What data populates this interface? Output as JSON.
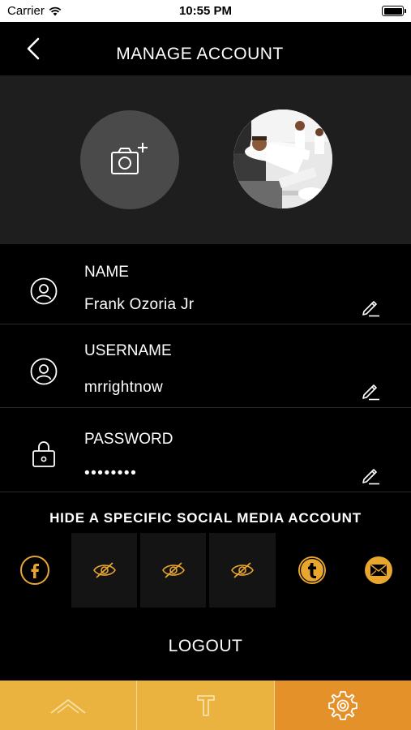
{
  "status_bar": {
    "carrier": "Carrier",
    "time": "10:55 PM"
  },
  "header": {
    "title": "MANAGE ACCOUNT",
    "back_icon": "chevron-left-icon"
  },
  "photos": {
    "add_icon": "camera-plus-icon",
    "avatar": "profile-photo"
  },
  "fields": [
    {
      "label": "NAME",
      "value": "Frank Ozoria Jr",
      "icon": "user-icon"
    },
    {
      "label": "USERNAME",
      "value": "mrrightnow",
      "icon": "user-icon"
    },
    {
      "label": "PASSWORD",
      "value": "••••••••",
      "icon": "lock-icon"
    }
  ],
  "social": {
    "heading": "HIDE A SPECIFIC SOCIAL MEDIA ACCOUNT",
    "items": [
      {
        "icon": "facebook-icon",
        "state": "visible"
      },
      {
        "icon": "eye-slash-icon",
        "state": "hidden"
      },
      {
        "icon": "eye-slash-icon",
        "state": "hidden"
      },
      {
        "icon": "eye-slash-icon",
        "state": "hidden"
      },
      {
        "icon": "tumblr-icon",
        "state": "visible"
      },
      {
        "icon": "mail-icon",
        "state": "visible"
      }
    ]
  },
  "logout_label": "LOGOUT",
  "tabs": [
    {
      "icon": "home-icon",
      "active": false
    },
    {
      "icon": "t-icon",
      "active": false
    },
    {
      "icon": "gear-icon",
      "active": true
    }
  ],
  "colors": {
    "accent": "#E9A62F",
    "tab_bar": "#EAB33F",
    "tab_active": "#E5912A",
    "panel": "#1E1E1E"
  }
}
